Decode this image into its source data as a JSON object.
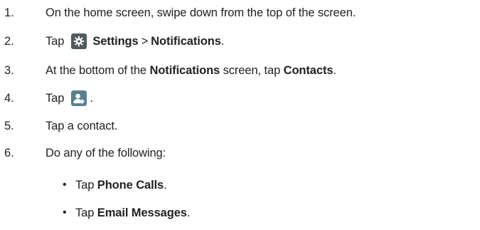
{
  "steps": [
    {
      "number": "1.",
      "text": "On the home screen, swipe down from the top of the screen."
    },
    {
      "number": "2.",
      "pre": "Tap",
      "settings": "Settings",
      "sep": ">",
      "notifications": "Notifications",
      "post": "."
    },
    {
      "number": "3.",
      "pre": "At the bottom of the",
      "notifications": "Notifications",
      "mid": "screen, tap",
      "contacts": "Contacts",
      "post": "."
    },
    {
      "number": "4.",
      "pre": "Tap",
      "post": "."
    },
    {
      "number": "5.",
      "text": "Tap a contact."
    },
    {
      "number": "6.",
      "text": "Do any of the following:"
    }
  ],
  "bullets": [
    {
      "pre": "Tap",
      "bold": "Phone Calls",
      "post": "."
    },
    {
      "pre": "Tap",
      "bold": "Email Messages",
      "post": "."
    }
  ],
  "icons": {
    "settings": "gear-icon",
    "add_contact": "add-contact-icon"
  },
  "colors": {
    "text": "#222222",
    "gear_icon_bg": "#4f5b5f",
    "contact_icon_bg": "#5b7f8f"
  }
}
